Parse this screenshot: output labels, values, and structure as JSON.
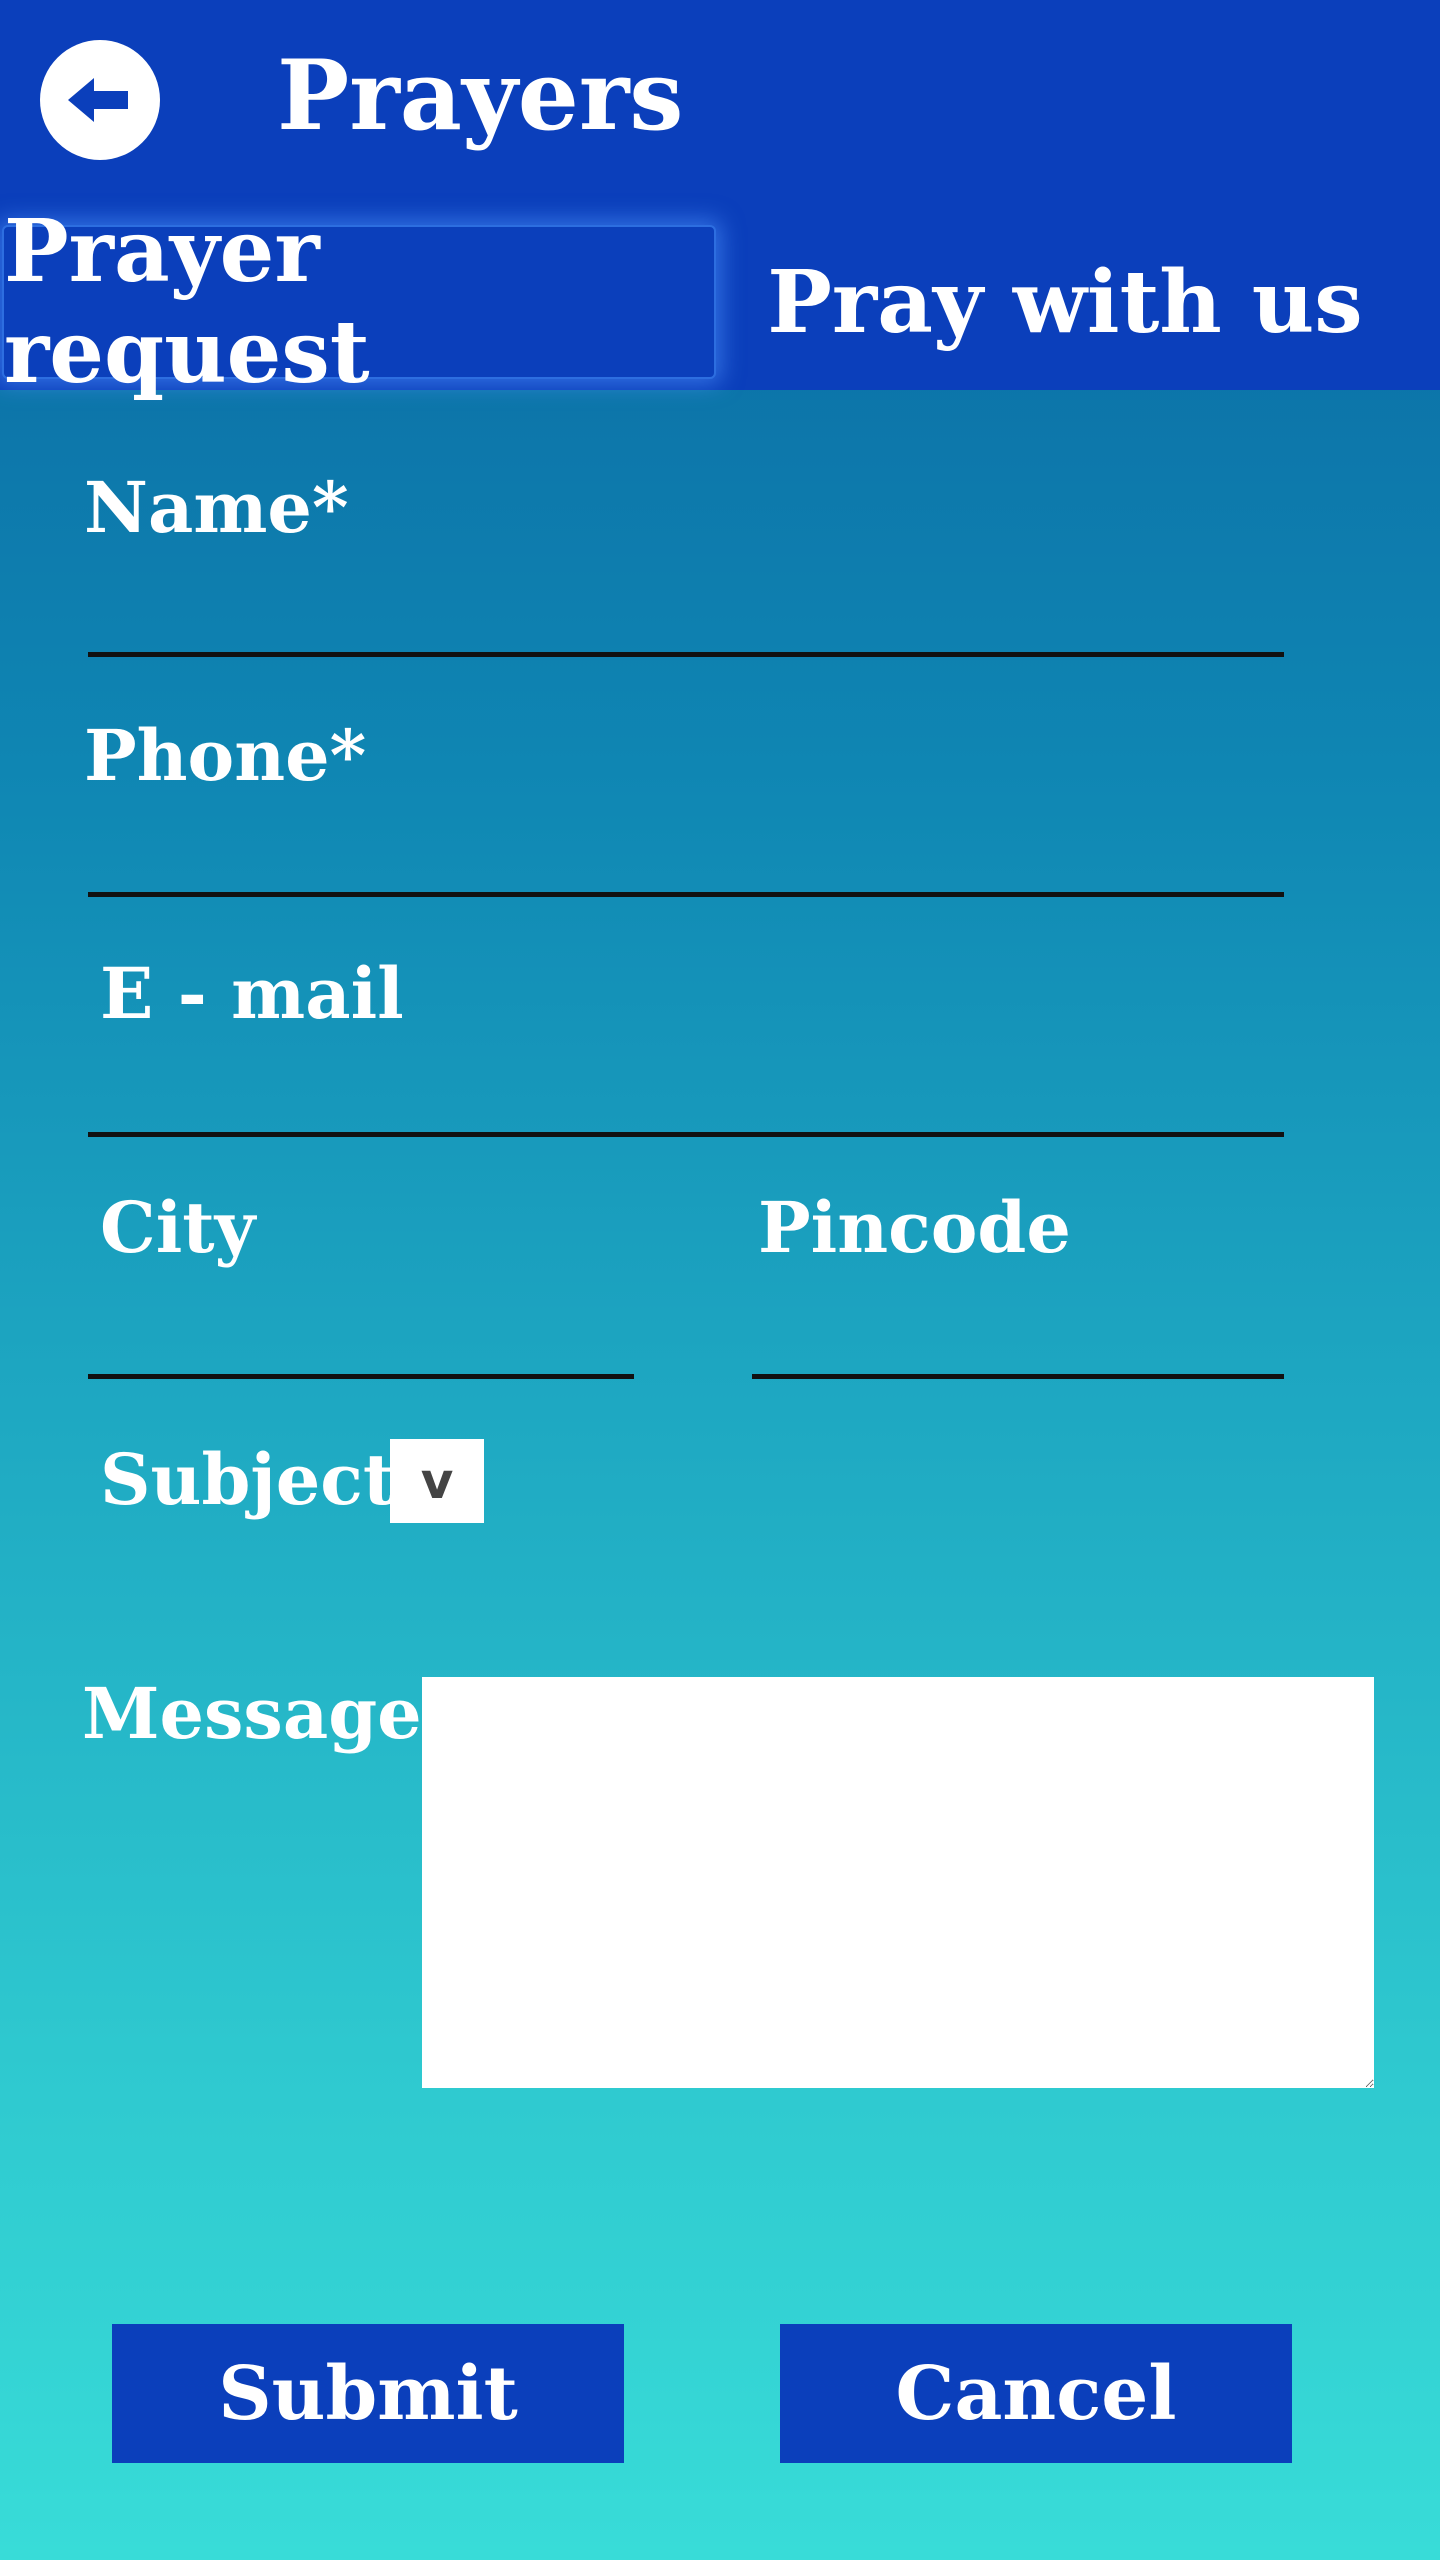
{
  "header": {
    "title": "Prayers",
    "back_icon": "arrow-left-icon",
    "bg_color": "#0b3fbb"
  },
  "tabs": [
    {
      "label": "Prayer request",
      "active": true
    },
    {
      "label": "Pray with us",
      "active": false
    }
  ],
  "form": {
    "name": {
      "label": "Name*",
      "value": ""
    },
    "phone": {
      "label": "Phone*",
      "value": ""
    },
    "email": {
      "label": "E - mail",
      "value": ""
    },
    "city": {
      "label": "City",
      "value": ""
    },
    "pincode": {
      "label": "Pincode",
      "value": ""
    },
    "subject": {
      "label": "Subject",
      "dropdown_glyph": "v",
      "value": ""
    },
    "message": {
      "label": "Message*",
      "value": ""
    }
  },
  "actions": {
    "submit_label": "Submit",
    "cancel_label": "Cancel"
  }
}
